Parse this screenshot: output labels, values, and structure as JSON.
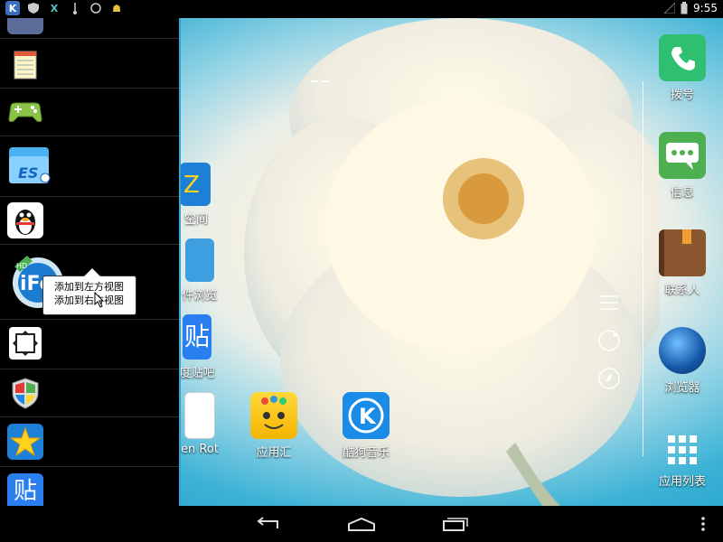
{
  "status_bar": {
    "left_icons": [
      "k-app-icon",
      "shield-icon",
      "xposed-icon",
      "usb-icon",
      "sync-icon",
      "android-icon"
    ],
    "time": "9:55"
  },
  "drawer": {
    "items": [
      {
        "icon": "app-icon",
        "type": "partial"
      },
      {
        "icon": "notepad-icon",
        "type": "app"
      },
      {
        "icon": "gamepad-icon",
        "type": "app"
      },
      {
        "icon": "es-file-icon",
        "type": "app"
      },
      {
        "icon": "qq-penguin-icon",
        "type": "app"
      },
      {
        "icon": "ifeng-hd-icon",
        "type": "app"
      },
      {
        "icon": "screen-rotate-icon",
        "type": "app"
      },
      {
        "icon": "shield-windows-icon",
        "type": "app"
      },
      {
        "icon": "star-app-icon",
        "type": "app"
      },
      {
        "icon": "tieba-icon",
        "type": "app"
      }
    ],
    "popup": {
      "line1": "添加到左方视图",
      "line2": "添加到右方视图"
    }
  },
  "home": {
    "partial_labels": {
      "qzone": "空间",
      "es_file": "件浏览",
      "tieba": "度贴吧",
      "rotate": "en Rot"
    },
    "apps": [
      {
        "label": "应用汇",
        "icon": "appchina-icon"
      },
      {
        "label": "酷狗音乐",
        "icon": "kugou-icon"
      }
    ],
    "dock": [
      {
        "label": "拨号",
        "icon": "phone-icon"
      },
      {
        "label": "信息",
        "icon": "messages-icon"
      },
      {
        "label": "联系人",
        "icon": "contacts-icon"
      },
      {
        "label": "浏览器",
        "icon": "browser-icon"
      },
      {
        "label": "应用列表",
        "icon": "app-grid-icon"
      }
    ]
  },
  "colors": {
    "accent": "#3aa3cc",
    "phone_green": "#2fbf71",
    "message_green": "#4caf50",
    "contacts_brown": "#7a4a2a"
  }
}
